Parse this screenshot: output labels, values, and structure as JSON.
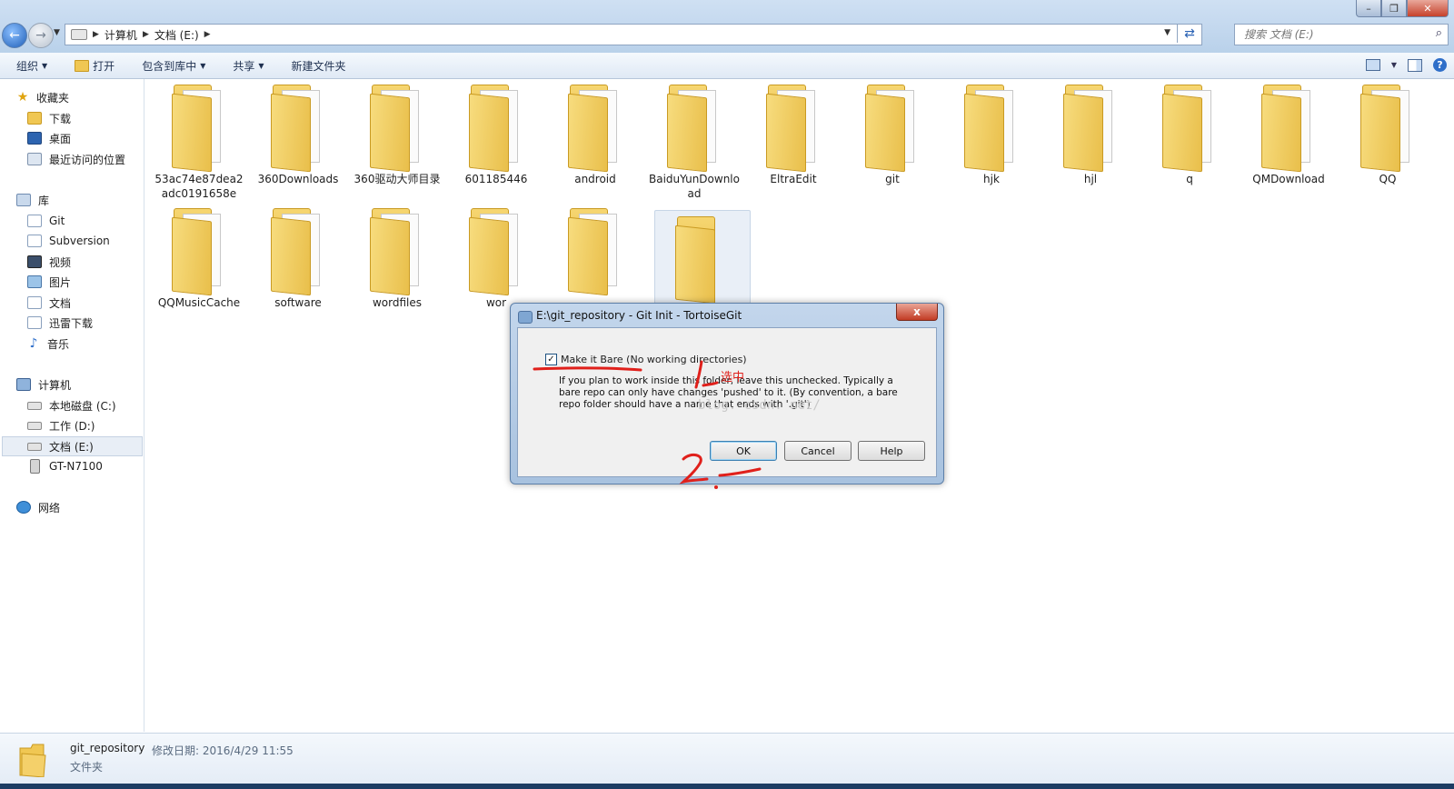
{
  "address": {
    "crumbs": [
      "计算机",
      "文档 (E:)"
    ],
    "search_placeholder": "搜索 文档 (E:)"
  },
  "toolbar": {
    "organize": "组织",
    "open": "打开",
    "include_library": "包含到库中",
    "share": "共享",
    "new_folder": "新建文件夹"
  },
  "nav": {
    "favorites": "收藏夹",
    "downloads": "下载",
    "desktop": "桌面",
    "recent": "最近访问的位置",
    "libraries": "库",
    "git": "Git",
    "subversion": "Subversion",
    "videos": "视频",
    "pictures": "图片",
    "documents": "文档",
    "xunlei": "迅雷下载",
    "music": "音乐",
    "computer": "计算机",
    "drive_c": "本地磁盘 (C:)",
    "drive_d": "工作 (D:)",
    "drive_e": "文档 (E:)",
    "phone": "GT-N7100",
    "network": "网络"
  },
  "files": [
    "53ac74e87dea2adc0191658e",
    "360Downloads",
    "360驱动大师目录",
    "601185446",
    "android",
    "BaiduYunDownload",
    "EltraEdit",
    "git",
    "hjk",
    "hjl",
    "q",
    "QMDownload",
    "QQ",
    "QQMusicCache",
    "software",
    "wordfiles",
    "wor",
    "",
    ""
  ],
  "dialog": {
    "title": "E:\\git_repository - Git Init - TortoiseGit",
    "checkbox_label": "Make it Bare (No working directories)",
    "checkbox_checked": true,
    "description": "If you plan to work inside this folder, leave this unchecked. Typically a bare repo can only have changes 'pushed' to it. (By convention, a bare repo folder should have a name that ends with '.git')",
    "watermark": "blog. csdn. net/",
    "ok": "OK",
    "cancel": "Cancel",
    "help": "Help",
    "close": "x"
  },
  "annotations": {
    "step1_note": "选中",
    "color": "#e0201b"
  },
  "details": {
    "name": "git_repository",
    "modified": "修改日期: 2016/4/29 11:55",
    "type": "文件夹"
  }
}
